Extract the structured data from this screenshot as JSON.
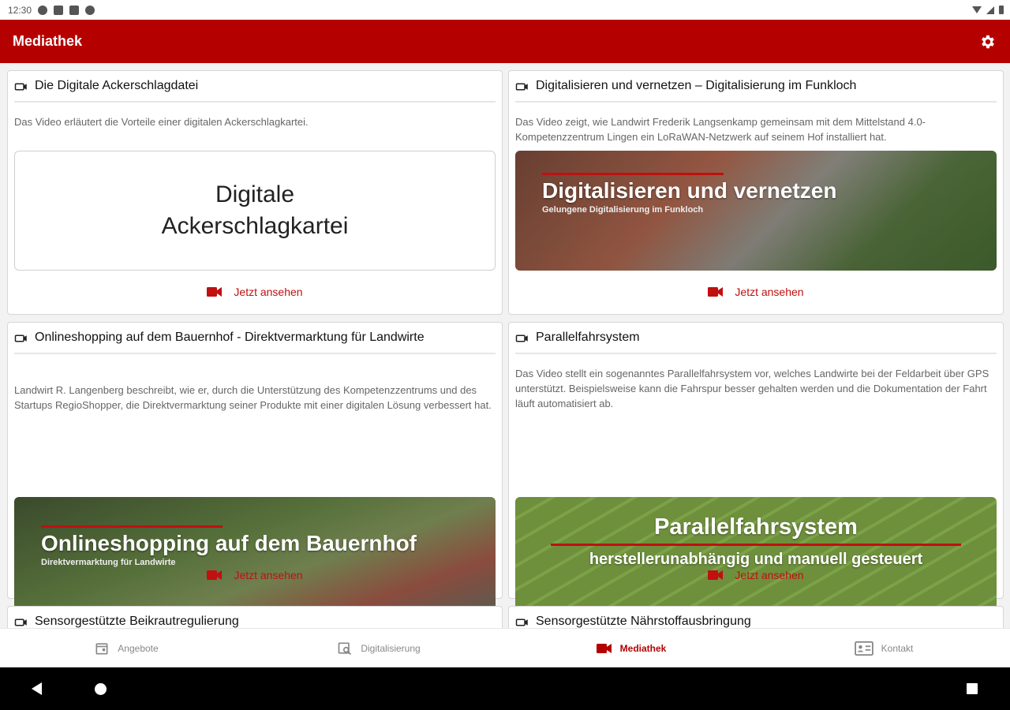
{
  "status": {
    "time": "12:30"
  },
  "appbar": {
    "title": "Mediathek"
  },
  "cards": [
    {
      "title": "Die Digitale Ackerschlagdatei",
      "description": "Das Video erläutert die Vorteile einer digitalen Ackerschlagkartei.",
      "thumb_text": "Digitale\nAckerschlagkartei",
      "action": "Jetzt ansehen"
    },
    {
      "title": "Digitalisieren und vernetzen – Digitalisierung im Funkloch",
      "description": "Das Video zeigt, wie Landwirt Frederik Langsenkamp gemeinsam mit dem Mittelstand 4.0-Kompetenzzentrum Lingen ein LoRaWAN-Netzwerk auf seinem Hof installiert hat.",
      "thumb_main": "Digitalisieren und vernetzen",
      "thumb_sub": "Gelungene Digitalisierung im Funkloch",
      "action": "Jetzt ansehen"
    },
    {
      "title": "Onlineshopping auf dem Bauernhof - Direktvermarktung für Landwirte",
      "description": "Landwirt R. Langenberg beschreibt, wie er, durch die Unterstützung des Kompetenzzentrums und des Startups RegioShopper, die Direktvermarktung seiner Produkte mit einer digitalen Lösung verbessert hat.",
      "thumb_main": "Onlineshopping auf dem Bauernhof",
      "thumb_sub": "Direktvermarktung für Landwirte",
      "action": "Jetzt ansehen"
    },
    {
      "title": "Parallelfahrsystem",
      "description": "Das Video stellt ein sogenanntes Parallelfahrsystem vor, welches Landwirte bei der Feldarbeit über GPS unterstützt. Beispielsweise kann die Fahrspur besser gehalten werden und die Dokumentation der Fahrt läuft automatisiert ab.",
      "thumb_main": "Parallelfahrsystem",
      "thumb_sub": "herstellerunabhängig und manuell gesteuert",
      "action": "Jetzt ansehen"
    },
    {
      "title": "Sensorgestützte Beikrautregulierung"
    },
    {
      "title": "Sensorgestützte Nährstoffausbringung"
    }
  ],
  "nav": [
    {
      "label": "Angebote"
    },
    {
      "label": "Digitalisierung"
    },
    {
      "label": "Mediathek",
      "active": true
    },
    {
      "label": "Kontakt"
    }
  ],
  "colors": {
    "brand": "#b50000",
    "accent": "#c01010"
  }
}
